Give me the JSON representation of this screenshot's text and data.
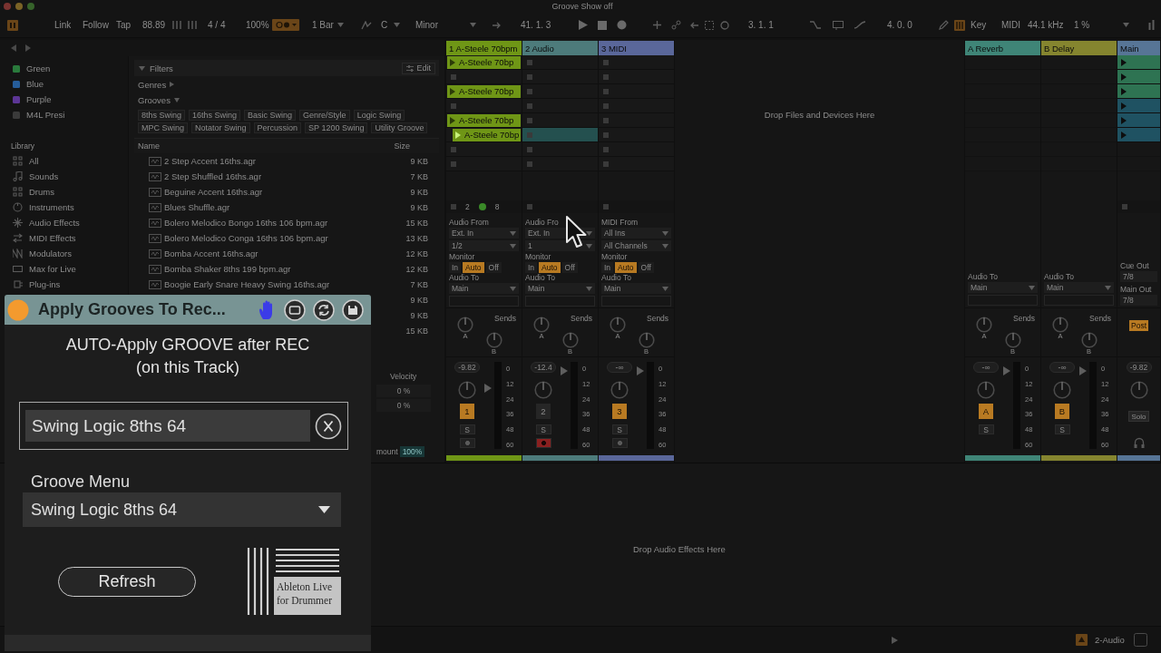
{
  "window": {
    "title": "Groove Show off"
  },
  "control_bar": {
    "link": "Link",
    "follow": "Follow",
    "tap": "Tap",
    "tempo": "88.89",
    "time_signature": "4 / 4",
    "zoom": "100%",
    "quantization": "1 Bar",
    "root_key": "C",
    "scale": "Minor",
    "song_position": "41. 1. 3",
    "loop_start": "3. 1. 1",
    "loop_length": "4. 0. 0",
    "key_map": "Key",
    "midi_map": "MIDI",
    "sample_rate": "44.1 kHz",
    "cpu_load": "1 %"
  },
  "browser": {
    "collections": [
      {
        "label": "Green",
        "color": "#2a7a3c"
      },
      {
        "label": "Blue",
        "color": "#265d9a"
      },
      {
        "label": "Purple",
        "color": "#5c3696"
      },
      {
        "label": "M4L Presi",
        "color": "#3a3a3a"
      }
    ],
    "library_title": "Library",
    "library": [
      {
        "label": "All"
      },
      {
        "label": "Sounds"
      },
      {
        "label": "Drums"
      },
      {
        "label": "Instruments"
      },
      {
        "label": "Audio Effects"
      },
      {
        "label": "MIDI Effects"
      },
      {
        "label": "Modulators"
      },
      {
        "label": "Max for Live"
      },
      {
        "label": "Plug-ins"
      }
    ],
    "filters": {
      "title": "Filters",
      "edit": "Edit",
      "groups": [
        {
          "label": "Genres",
          "expanded": false
        },
        {
          "label": "Grooves",
          "expanded": true
        }
      ],
      "tag_rows": [
        [
          "8ths Swing",
          "16ths Swing",
          "Basic Swing",
          "Genre/Style",
          "Logic Swing"
        ],
        [
          "MPC Swing",
          "Notator Swing",
          "Percussion",
          "SP 1200 Swing",
          "Utility Groove"
        ]
      ]
    },
    "columns": [
      "Name",
      "Size"
    ],
    "files": [
      {
        "name": "2 Step Accent 16ths.agr",
        "size": "9 KB"
      },
      {
        "name": "2 Step Shuffled 16ths.agr",
        "size": "7 KB"
      },
      {
        "name": "Beguine Accent 16ths.agr",
        "size": "9 KB"
      },
      {
        "name": "Blues Shuffle.agr",
        "size": "9 KB"
      },
      {
        "name": "Bolero Melodico Bongo 16ths 106 bpm.agr",
        "size": "15 KB"
      },
      {
        "name": "Bolero Melodico Conga 16ths 106 bpm.agr",
        "size": "13 KB"
      },
      {
        "name": "Bomba Accent 16ths.agr",
        "size": "12 KB"
      },
      {
        "name": "Bomba Shaker 8ths 199 bpm.agr",
        "size": "12 KB"
      },
      {
        "name": "Boogie Early Snare Heavy Swing 16ths.agr",
        "size": "7 KB"
      },
      {
        "size": "9 KB"
      },
      {
        "size": "9 KB"
      },
      {
        "size": "15 KB"
      }
    ]
  },
  "groove_pool": {
    "column": "Velocity",
    "values": [
      "0 %",
      "0 %"
    ],
    "amount_label": "mount",
    "amount": "100%"
  },
  "session": {
    "tracks": [
      {
        "name": "1 A-Steele 70bpm",
        "color": "#6f9616",
        "slots": [
          {
            "kind": "clip",
            "name": "A-Steele 70bp",
            "playing": false,
            "selected": false
          },
          {
            "kind": "empty",
            "selected": false
          },
          {
            "kind": "clip",
            "name": "A-Steele 70bp",
            "playing": false,
            "selected": false
          },
          {
            "kind": "empty",
            "selected": false
          },
          {
            "kind": "clip",
            "name": "A-Steele 70bp",
            "playing": false,
            "selected": false
          },
          {
            "kind": "clip",
            "name": "A-Steele 70bp",
            "playing": true,
            "selected": false
          },
          {
            "kind": "empty",
            "selected": false
          },
          {
            "kind": "empty",
            "selected": false
          }
        ],
        "status": [
          "2",
          "8"
        ],
        "input": {
          "label": "Audio From",
          "source": "Ext. In",
          "channel": "1/2"
        },
        "monitor_label": "Monitor",
        "monitor": [
          {
            "label": "In",
            "selected": false
          },
          {
            "label": "Auto",
            "selected": true
          },
          {
            "label": "Off",
            "selected": false
          }
        ],
        "output": {
          "label": "Audio To",
          "target": "Main"
        },
        "sends_label": "Sends",
        "sends": [
          "A",
          "B"
        ],
        "volume": "-9.82",
        "level": 0.7,
        "number": "1",
        "on": true,
        "solo": "S",
        "armed": false,
        "meter_scale": [
          "0",
          "12",
          "24",
          "36",
          "48",
          "60"
        ]
      },
      {
        "name": "2 Audio",
        "color": "#4d7b7b",
        "slots": [
          {
            "kind": "empty",
            "selected": false
          },
          {
            "kind": "empty",
            "selected": false
          },
          {
            "kind": "empty",
            "selected": false
          },
          {
            "kind": "empty",
            "selected": false
          },
          {
            "kind": "empty",
            "selected": false
          },
          {
            "kind": "empty",
            "selected": true
          },
          {
            "kind": "empty",
            "selected": false
          },
          {
            "kind": "empty",
            "selected": false
          }
        ],
        "input": {
          "label": "Audio Fro",
          "source": "Ext. In",
          "channel": "1"
        },
        "monitor_label": "Monitor",
        "monitor": [
          {
            "label": "In",
            "selected": false
          },
          {
            "label": "Auto",
            "selected": true
          },
          {
            "label": "Off",
            "selected": false
          }
        ],
        "output": {
          "label": "Audio To",
          "target": "Main"
        },
        "sends_label": "Sends",
        "sends": [
          "A",
          "B"
        ],
        "volume": "-12.4",
        "level": 0.9,
        "number": "2",
        "on": false,
        "solo": "S",
        "armed": true,
        "meter_scale": [
          "0",
          "12",
          "24",
          "36",
          "48",
          "60"
        ]
      },
      {
        "name": "3 MIDI",
        "color": "#5a679a",
        "slots": [
          {
            "kind": "empty",
            "selected": false
          },
          {
            "kind": "empty",
            "selected": false
          },
          {
            "kind": "empty",
            "selected": false
          },
          {
            "kind": "empty",
            "selected": false
          },
          {
            "kind": "empty",
            "selected": false
          },
          {
            "kind": "empty",
            "selected": false
          },
          {
            "kind": "empty",
            "selected": false
          },
          {
            "kind": "empty",
            "selected": false
          }
        ],
        "input": {
          "label": "MIDI From",
          "source": "All Ins",
          "channel": "All Channels"
        },
        "monitor_label": "Monitor",
        "monitor": [
          {
            "label": "In",
            "selected": false
          },
          {
            "label": "Auto",
            "selected": true
          },
          {
            "label": "Off",
            "selected": false
          }
        ],
        "output": {
          "label": "Audio To",
          "target": "Main"
        },
        "sends_label": "Sends",
        "sends": [
          "A",
          "B"
        ],
        "volume": "-∞",
        "level": 0.9,
        "number": "3",
        "on": true,
        "solo": "S",
        "armed": false,
        "meter_scale": [
          "0",
          "12",
          "24",
          "36",
          "48",
          "60"
        ]
      }
    ],
    "drop_hint": "Drop Files and Devices Here",
    "returns": [
      {
        "name": "A Reverb",
        "color": "#3f8577",
        "output": {
          "label": "Audio To",
          "target": "Main"
        },
        "sends_label": "Sends",
        "sends": [
          "A",
          "B"
        ],
        "volume": "-∞",
        "level": 0.9,
        "number": "A",
        "on": true,
        "solo": "S",
        "meter_scale": [
          "0",
          "12",
          "24",
          "36",
          "48",
          "60"
        ]
      },
      {
        "name": "B Delay",
        "color": "#85852f",
        "output": {
          "label": "Audio To",
          "target": "Main"
        },
        "sends_label": "Sends",
        "sends": [
          "A",
          "B"
        ],
        "volume": "-∞",
        "level": 0.9,
        "number": "B",
        "on": true,
        "solo": "S",
        "meter_scale": [
          "0",
          "12",
          "24",
          "36",
          "48",
          "60"
        ]
      }
    ],
    "main": {
      "name": "Main",
      "color": "#577596",
      "scenes": [
        {
          "color": "#2e7352"
        },
        {
          "color": "#2e7352"
        },
        {
          "color": "#2e7352"
        },
        {
          "color": "#1f5262"
        },
        {
          "color": "#1f5262"
        },
        {
          "color": "#1f5262"
        }
      ],
      "cue_label": "Cue Out",
      "cue": "7/8",
      "out_label": "Main Out",
      "out": "7/8",
      "post": "Post",
      "volume": "-9.82",
      "solo": "Solo"
    }
  },
  "device_view": {
    "drop_hint": "Drop Audio Effects Here"
  },
  "status_bar": {
    "selected_track": "2-Audio"
  },
  "plugin": {
    "title": "Apply Grooves To Rec...",
    "heading": "AUTO-Apply GROOVE after REC\n(on this Track)",
    "groove_field": "Swing Logic 8ths 64",
    "menu_label": "Groove Menu",
    "menu_value": "Swing Logic 8ths 64",
    "refresh": "Refresh",
    "logo_text": "Ableton Live\nfor Drummer"
  }
}
